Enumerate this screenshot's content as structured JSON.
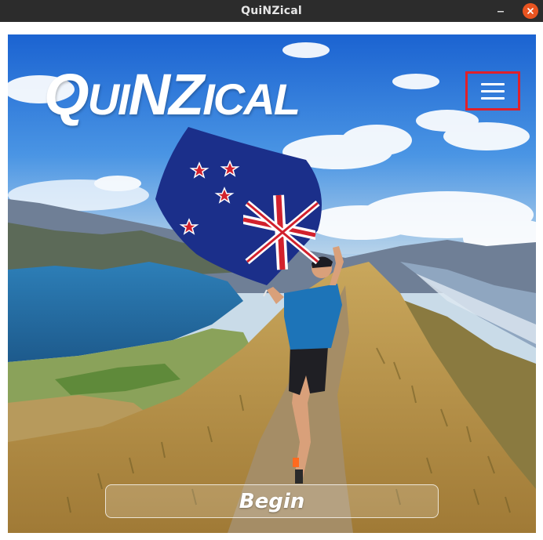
{
  "window": {
    "title": "QuiNZical"
  },
  "app": {
    "logo_text": "QuiNZical",
    "menu_icon": "hamburger-icon",
    "begin_label": "Begin"
  },
  "colors": {
    "titlebar": "#2c2c2c",
    "close_button": "#e95420",
    "menu_highlight": "#e0202a"
  }
}
